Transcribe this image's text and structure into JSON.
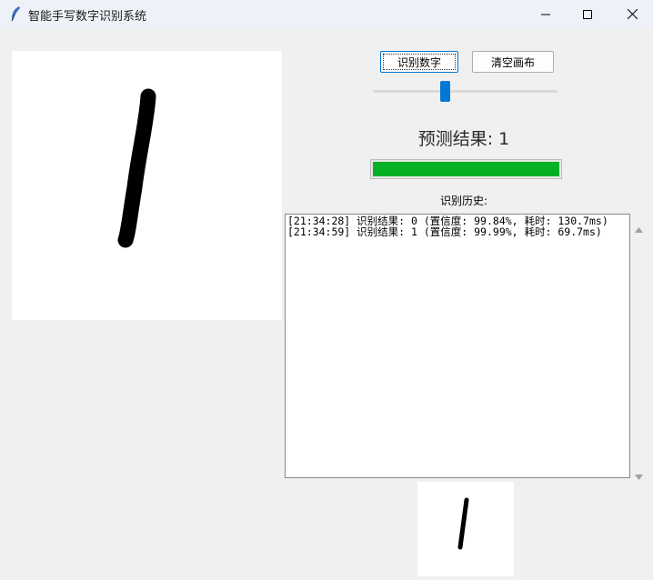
{
  "window": {
    "title": "智能手写数字识别系统",
    "icon": "feather-icon"
  },
  "toolbar": {
    "recognize_label": "识别数字",
    "clear_label": "清空画布"
  },
  "slider": {
    "value_fraction": 0.39
  },
  "result": {
    "text": "预测结果: 1"
  },
  "confidence_bar": {
    "percent": 99.99,
    "color": "#06b025"
  },
  "history": {
    "label": "识别历史:",
    "lines": [
      "[21:34:28] 识别结果: 0 (置信度: 99.84%, 耗时: 130.7ms)",
      "[21:34:59] 识别结果: 1 (置信度: 99.99%, 耗时: 69.7ms)"
    ]
  },
  "colors": {
    "accent": "#0078d4",
    "progress": "#06b025"
  }
}
